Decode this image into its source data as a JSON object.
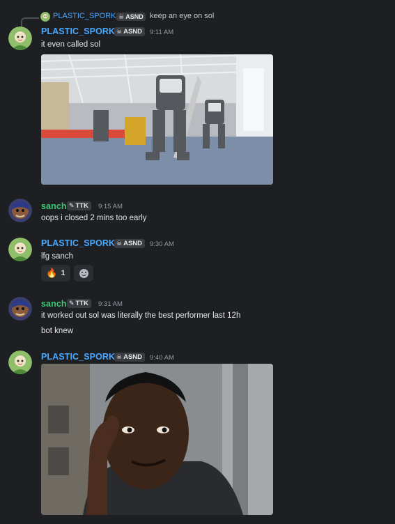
{
  "reply": {
    "author": "PLASTIC_SPORK",
    "tag": "ASND",
    "text": "keep an eye on sol"
  },
  "messages": [
    {
      "author": "PLASTIC_SPORK",
      "tag": "ASND",
      "time": "9:11 AM",
      "lines": [
        "it even called sol"
      ],
      "image": "robots-dancing-gif"
    },
    {
      "author": "sanch",
      "tag": "TTK",
      "time": "9:15 AM",
      "lines": [
        "oops i closed 2 mins too early"
      ]
    },
    {
      "author": "PLASTIC_SPORK",
      "tag": "ASND",
      "time": "9:30 AM",
      "lines": [
        "lfg sanch"
      ],
      "reactions": [
        {
          "emoji": "fire-icon",
          "glyph": "🔥",
          "count": "1"
        },
        {
          "emoji": "add-reaction-icon"
        }
      ]
    },
    {
      "author": "sanch",
      "tag": "TTK",
      "time": "9:31 AM",
      "lines": [
        "it worked out sol was literally the best performer last 12h",
        "bot knew"
      ]
    },
    {
      "author": "PLASTIC_SPORK",
      "tag": "ASND",
      "time": "9:40 AM",
      "lines": [],
      "image": "roll-safe-meme"
    }
  ],
  "colors": {
    "background": "#1e1f22",
    "spork_name": "#4aa8ff",
    "sanch_name": "#3fc77a",
    "timestamp": "#949ba4"
  }
}
